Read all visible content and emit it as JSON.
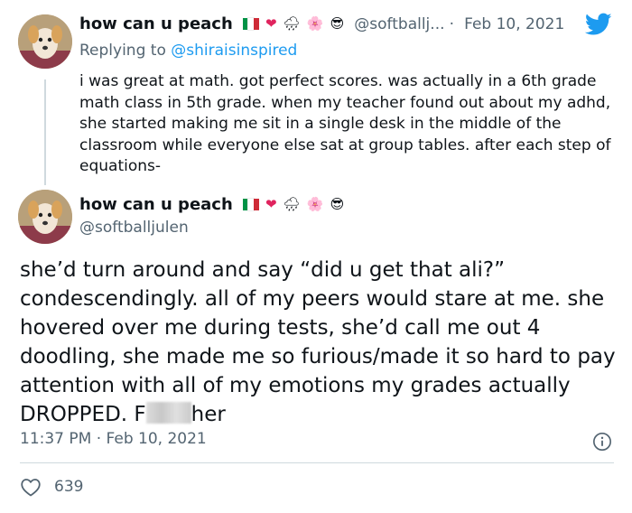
{
  "tweet1": {
    "display_name": "how can u peach",
    "handle": "@softballj...",
    "separator": "·",
    "date": "Feb 10, 2021",
    "replying_prefix": "Replying to",
    "replying_to": "@shiraisinspired",
    "text": "i was great at math. got perfect scores. was actually in a 6th grade math class in 5th grade. when my teacher found out about my adhd, she started making me sit in a single desk in the middle of the classroom while everyone else sat at group tables. after each step of equations-"
  },
  "tweet2": {
    "display_name": "how can u peach",
    "handle": "@softballjulen",
    "text_before": "she’d turn around and say “did u get that ali?” condescendingly. all of my peers would stare at me. she hovered over me during tests, she’d call me out 4 doodling, she made me so furious/made it so hard to pay attention with all of my emotions my grades actually DROPPED. F",
    "text_after": "her",
    "time": "11:37 PM",
    "separator": "·",
    "date": "Feb 10, 2021",
    "likes": "639"
  },
  "emojis": {
    "heart": "❤",
    "cloud": "🌧",
    "flower": "🌸",
    "cool": "😎"
  },
  "icons": [
    "italy-flag-icon",
    "red-heart-icon",
    "rain-cloud-icon",
    "cherry-blossom-icon",
    "sunglasses-face-icon",
    "twitter-bird-icon",
    "info-icon",
    "heart-like-icon"
  ],
  "colors": {
    "accent": "#1d9bf0",
    "muted": "#536471",
    "text": "#0f1419",
    "divider": "#cfd9de"
  }
}
